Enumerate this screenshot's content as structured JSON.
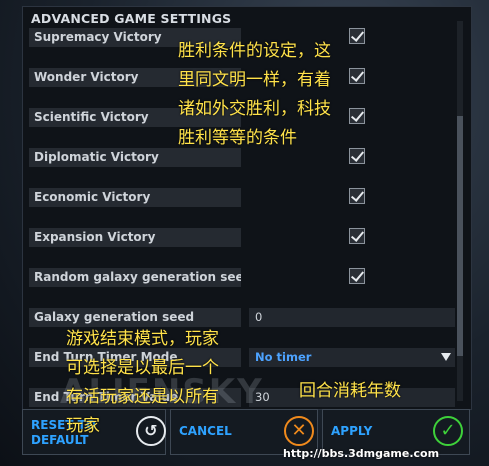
{
  "panel": {
    "title": "ADVANCED GAME SETTINGS",
    "rows": [
      {
        "label": "Supremacy Victory",
        "checked": true
      },
      {
        "label": "Wonder Victory",
        "checked": true
      },
      {
        "label": "Scientific Victory",
        "checked": true
      },
      {
        "label": "Diplomatic Victory",
        "checked": true
      },
      {
        "label": "Economic Victory",
        "checked": true
      },
      {
        "label": "Expansion Victory",
        "checked": true
      },
      {
        "label": "Random galaxy generation seed",
        "checked": true
      }
    ],
    "galaxy_seed": {
      "label": "Galaxy generation seed",
      "value": "0"
    },
    "end_turn_timer_mode": {
      "label": "End Turn Timer Mode",
      "value": "No timer"
    },
    "end_turn_timer_value": {
      "label": "End Turn Timer Value",
      "value": "30"
    }
  },
  "buttons": {
    "reset_line1": "RESET TO",
    "reset_line2": "DEFAULT",
    "cancel": "CANCEL",
    "apply": "APPLY"
  },
  "annotations": {
    "victory_note_lines": [
      "胜利条件的设定，这",
      "里同文明一样，有着",
      "诸如外交胜利，科技",
      "胜利等等的条件"
    ],
    "mode_note_lines": [
      "游戏结束模式，玩家",
      "可选择是以最后一个",
      "存活玩家还是以所有",
      "玩家"
    ],
    "timer_note": "回合消耗年数"
  },
  "watermark": "ALIENSKY",
  "url": "http://bbs.3dmgame.com",
  "colors": {
    "accent": "#2ea2ff",
    "cancel_icon": "#f08a1c",
    "apply_icon": "#3ed13a",
    "note": "#ffe24a"
  }
}
